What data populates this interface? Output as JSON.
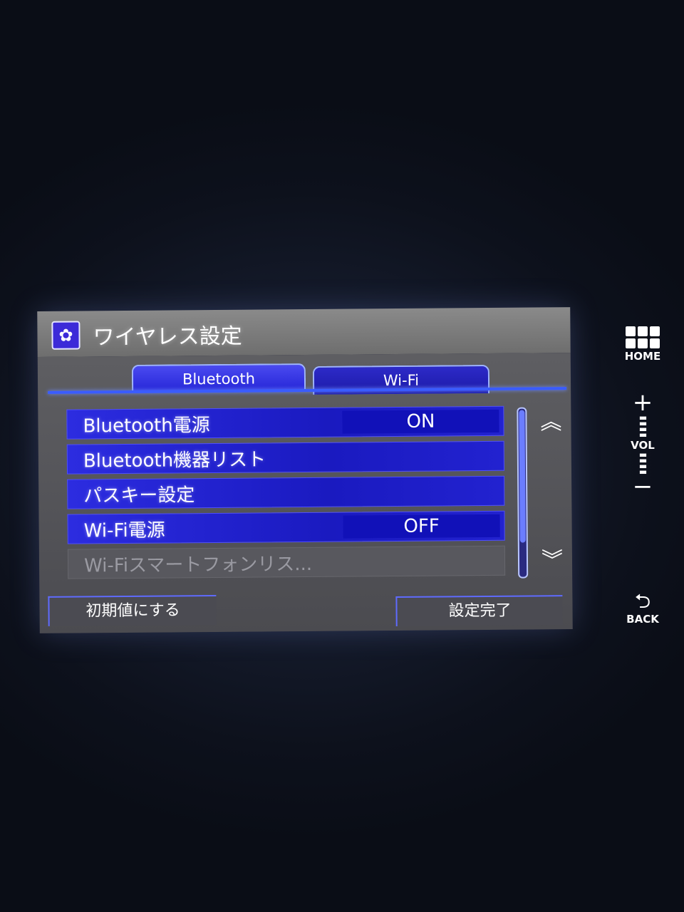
{
  "window": {
    "title": "ワイヤレス設定",
    "icon": "gear-icon"
  },
  "tabs": [
    {
      "label": "Bluetooth",
      "active": true
    },
    {
      "label": "Wi-Fi",
      "active": false
    }
  ],
  "list": [
    {
      "label": "Bluetooth電源",
      "value": "ON"
    },
    {
      "label": "Bluetooth機器リスト"
    },
    {
      "label": "パスキー設定"
    },
    {
      "label": "Wi-Fi電源",
      "value": "OFF"
    },
    {
      "label": "Wi-Fiスマートフォンリス...",
      "disabled": true
    }
  ],
  "buttons": {
    "reset": "初期値にする",
    "done": "設定完了"
  },
  "hardware": {
    "home": "HOME",
    "vol": "VOL",
    "plus": "+",
    "minus": "−",
    "back": "BACK"
  },
  "colors": {
    "accent": "#2424d6",
    "tab_active": "#3a5cff",
    "titlebar": "#7a7a7a"
  }
}
